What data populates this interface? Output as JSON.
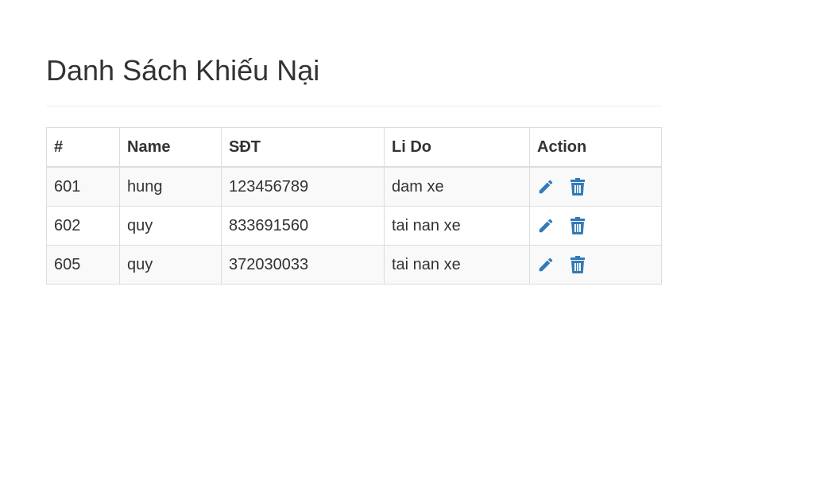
{
  "page": {
    "title": "Danh Sách Khiếu Nại"
  },
  "table": {
    "headers": [
      "#",
      "Name",
      "SĐT",
      "Li Do",
      "Action"
    ],
    "rows": [
      {
        "id": "601",
        "name": "hung",
        "phone": "123456789",
        "reason": "dam xe"
      },
      {
        "id": "602",
        "name": "quy",
        "phone": "833691560",
        "reason": "tai nan xe"
      },
      {
        "id": "605",
        "name": "quy",
        "phone": "372030033",
        "reason": "tai nan xe"
      }
    ]
  },
  "icons": {
    "edit": "pencil-icon",
    "delete": "trash-icon"
  },
  "colors": {
    "icon": "#337ab7",
    "text": "#333333",
    "border": "#dddddd",
    "stripe": "#f9f9f9"
  }
}
